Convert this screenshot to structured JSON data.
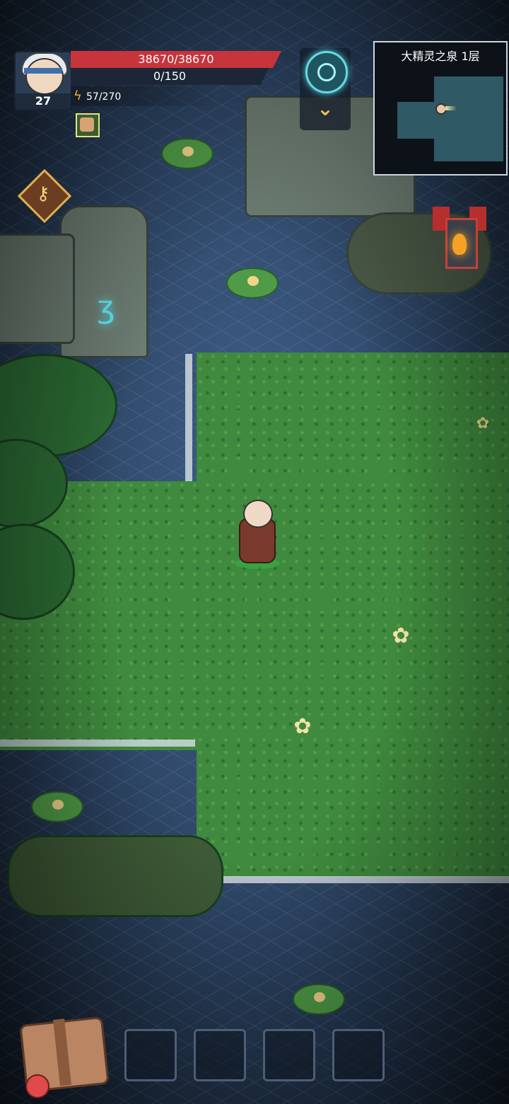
{
  "hud": {
    "level": "27",
    "hp_text": "38670/38670",
    "mp_text": "0/150",
    "energy_text": "57/270",
    "energy_icon": "lightning-icon",
    "avatar_icon": "hero-portrait"
  },
  "minimap": {
    "title": "大精灵之泉 1层"
  },
  "buttons": {
    "portal_icon": "portal-icon",
    "chevron_glyph": "⌄",
    "key_glyph": "⚷",
    "inventory_icon": "backpack-icon"
  },
  "quickslots": [
    "",
    "",
    "",
    ""
  ],
  "colors": {
    "hp": "#c8343b",
    "accent": "#f2c34a",
    "portal": "#67d8e0"
  }
}
